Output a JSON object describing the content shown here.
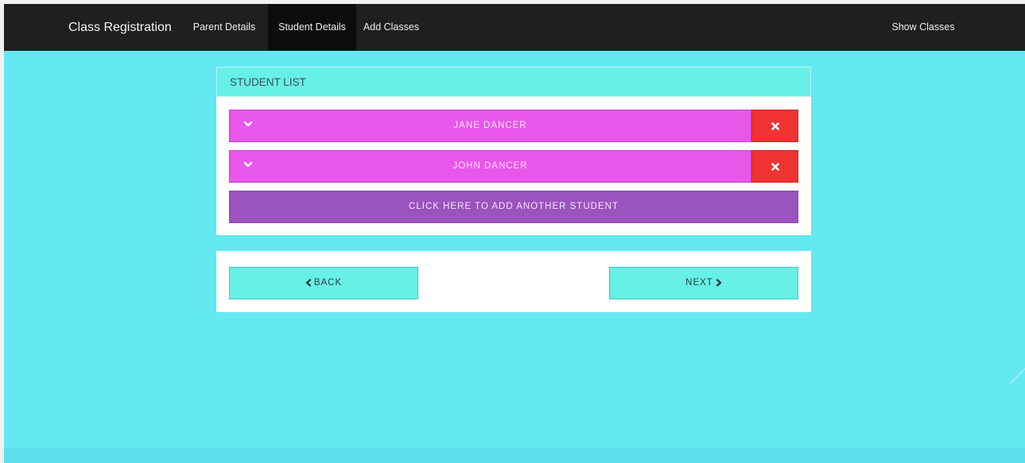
{
  "navbar": {
    "brand": "Class Registration",
    "items": [
      {
        "label": "Parent Details",
        "active": false
      },
      {
        "label": "Student Details",
        "active": true
      },
      {
        "label": "Add Classes",
        "active": false
      }
    ],
    "right_item": "Show Classes"
  },
  "student_list": {
    "heading": "STUDENT LIST",
    "students": [
      {
        "name": "JANE DANCER",
        "expand_icon": "chevron-down-icon",
        "delete_icon": "close-icon"
      },
      {
        "name": "JOHN DANCER",
        "expand_icon": "chevron-down-icon",
        "delete_icon": "close-icon"
      }
    ],
    "add_button_label": "CLICK HERE TO ADD ANOTHER STUDENT"
  },
  "navigation": {
    "back_label": "BACK",
    "back_icon": "chevron-left-icon",
    "next_label": "NEXT",
    "next_icon": "chevron-right-icon"
  },
  "colors": {
    "page_background": "#64e8f2",
    "navbar": "#1f1f1f",
    "heading": "#66f0e6",
    "student_bar": "#e957ea",
    "delete_button": "#ef3333",
    "add_button": "#9b53bd",
    "nav_button": "#66f0e6"
  }
}
